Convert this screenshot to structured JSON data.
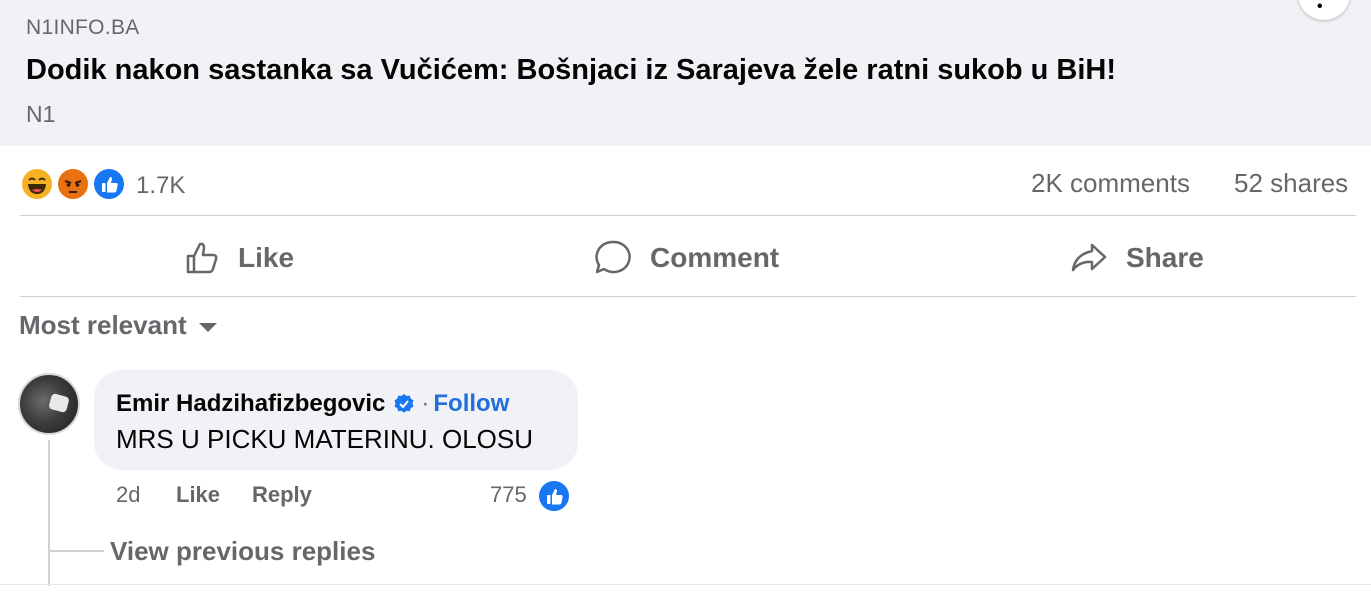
{
  "preview": {
    "domain": "N1INFO.BA",
    "headline": "Dodik nakon sastanka sa Vučićem: Bošnjaci iz Sarajeva žele ratni sukob u BiH!",
    "source": "N1"
  },
  "stats": {
    "reactions": [
      "haha-icon",
      "angry-icon",
      "like-icon"
    ],
    "reaction_count": "1.7K",
    "comments": "2K comments",
    "shares": "52 shares"
  },
  "actions": {
    "like": "Like",
    "comment": "Comment",
    "share": "Share"
  },
  "sort": {
    "label": "Most relevant"
  },
  "comment": {
    "author": "Emir Hadzihafizbegovic",
    "follow_separator": "·",
    "follow": "Follow",
    "text": "MRS U PICKU MATERINU. OLOSU",
    "time": "2d",
    "like": "Like",
    "reply": "Reply",
    "reaction_count": "775"
  },
  "thread": {
    "view_previous": "View previous replies"
  },
  "colors": {
    "facebook_blue": "#1877f2",
    "follow_blue": "#216fdb",
    "secondary_text": "#65676b",
    "card_bg": "#f0f2f5"
  }
}
